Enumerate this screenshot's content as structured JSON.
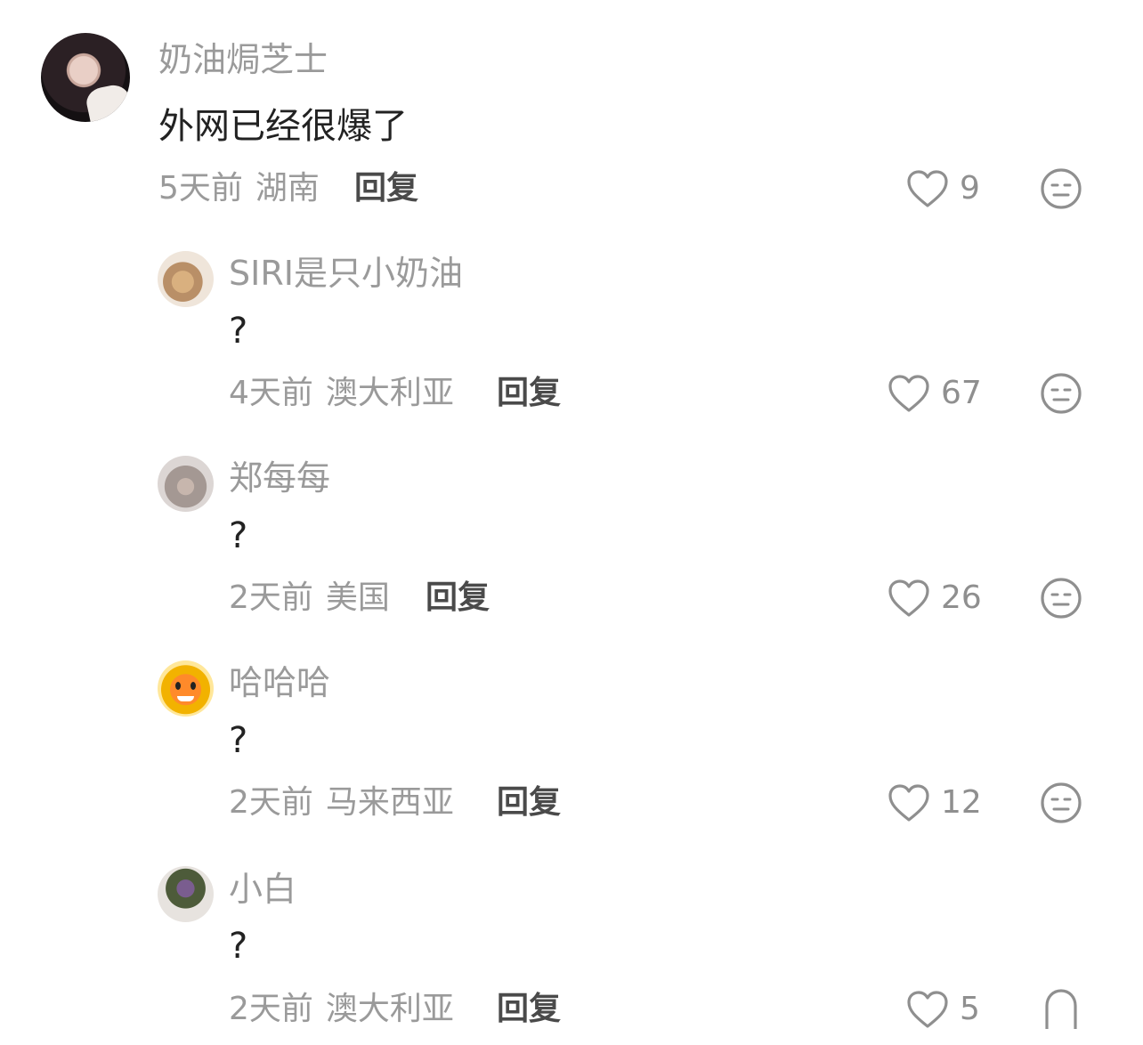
{
  "comments": [
    {
      "username": "奶油焗芝士",
      "text": "外网已经很爆了",
      "time": "5天前",
      "location": "湖南",
      "reply_label": "回复",
      "likes": "9"
    },
    {
      "username": "SIRI是只小奶油",
      "text": "?",
      "time": "4天前",
      "location": "澳大利亚",
      "reply_label": "回复",
      "likes": "67"
    },
    {
      "username": "郑每每",
      "text": "?",
      "time": "2天前",
      "location": "美国",
      "reply_label": "回复",
      "likes": "26"
    },
    {
      "username": "哈哈哈",
      "text": "?",
      "time": "2天前",
      "location": "马来西亚",
      "reply_label": "回复",
      "likes": "12"
    },
    {
      "username": "小白",
      "text": "?",
      "time": "2天前",
      "location": "澳大利亚",
      "reply_label": "回复",
      "likes": "5"
    }
  ],
  "icons": {
    "like": "heart-icon",
    "dislike": "meh-face-icon"
  },
  "colors": {
    "username": "#9a9a9a",
    "text": "#222222",
    "meta": "#9a9a9a",
    "reply": "#4a4a4a",
    "icon": "#8f8f8f"
  }
}
